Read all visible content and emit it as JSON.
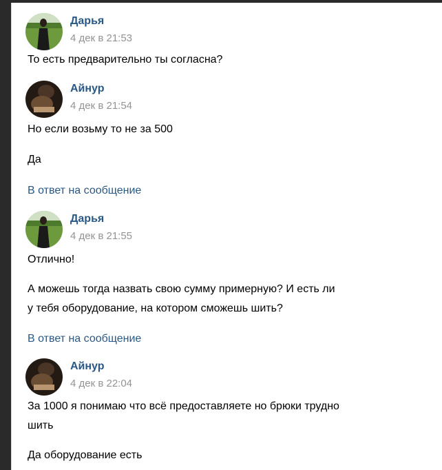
{
  "messages": [
    {
      "author": "Дарья",
      "date": "4 дек в 21:53",
      "avatar": "woman-in-field",
      "paragraphs": [
        "То есть предварительно ты согласна?"
      ]
    },
    {
      "author": "Айнур",
      "date": "4 дек в 21:54",
      "avatar": "dark-photo",
      "paragraphs": [
        "Но если возьму то не за 500",
        "Да"
      ],
      "reply_link": "В ответ на сообщение"
    },
    {
      "author": "Дарья",
      "date": "4 дек в 21:55",
      "avatar": "woman-in-field",
      "paragraphs": [
        "Отлично!",
        "А можешь тогда назвать свою сумму примерную? И есть ли",
        "у тебя оборудование, на котором сможешь шить?"
      ],
      "reply_link": "В ответ на сообщение"
    },
    {
      "author": "Айнур",
      "date": "4 дек в 22:04",
      "avatar": "dark-photo",
      "paragraphs": [
        "За 1000 я понимаю что всё предоставляете но брюки трудно",
        "шить",
        "Да оборудование есть"
      ]
    }
  ],
  "colors": {
    "author": "#2a5885",
    "date": "#939393",
    "link": "#2a5885",
    "background": "#ffffff"
  }
}
